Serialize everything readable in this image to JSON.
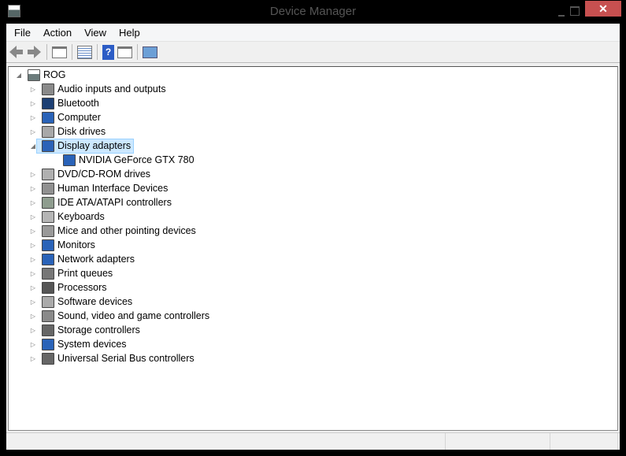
{
  "window": {
    "title": "Device Manager",
    "close": "✕"
  },
  "menu": [
    "File",
    "Action",
    "View",
    "Help"
  ],
  "toolbar": [
    "back-icon",
    "forward-icon",
    "show-hide-console-tree-icon",
    "properties-icon",
    "help-icon",
    "show-action-pane-icon",
    "scan-hardware-icon"
  ],
  "tree": {
    "root": "ROG",
    "categories": [
      {
        "label": "Audio inputs and outputs",
        "icon": "speaker-icon",
        "color": "#8a8a8a"
      },
      {
        "label": "Bluetooth",
        "icon": "bluetooth-icon",
        "color": "#1c3f73"
      },
      {
        "label": "Computer",
        "icon": "computer-icon",
        "color": "#2a63b8"
      },
      {
        "label": "Disk drives",
        "icon": "disk-drive-icon",
        "color": "#a8a8a8"
      },
      {
        "label": "Display adapters",
        "icon": "display-adapter-icon",
        "color": "#2a63b8",
        "expanded": true,
        "selected": true,
        "children": [
          "NVIDIA GeForce GTX 780"
        ]
      },
      {
        "label": "DVD/CD-ROM drives",
        "icon": "dvd-drive-icon",
        "color": "#b0b0b0"
      },
      {
        "label": "Human Interface Devices",
        "icon": "hid-icon",
        "color": "#909090"
      },
      {
        "label": "IDE ATA/ATAPI controllers",
        "icon": "ide-controller-icon",
        "color": "#8f9d8f"
      },
      {
        "label": "Keyboards",
        "icon": "keyboard-icon",
        "color": "#b5b5b5"
      },
      {
        "label": "Mice and other pointing devices",
        "icon": "mouse-icon",
        "color": "#999"
      },
      {
        "label": "Monitors",
        "icon": "monitor-icon",
        "color": "#2a63b8"
      },
      {
        "label": "Network adapters",
        "icon": "network-adapter-icon",
        "color": "#2a63b8"
      },
      {
        "label": "Print queues",
        "icon": "printer-icon",
        "color": "#777"
      },
      {
        "label": "Processors",
        "icon": "processor-icon",
        "color": "#555"
      },
      {
        "label": "Software devices",
        "icon": "software-device-icon",
        "color": "#aaa"
      },
      {
        "label": "Sound, video and game controllers",
        "icon": "sound-icon",
        "color": "#8a8a8a"
      },
      {
        "label": "Storage controllers",
        "icon": "storage-controller-icon",
        "color": "#666"
      },
      {
        "label": "System devices",
        "icon": "system-devices-icon",
        "color": "#2a63b8"
      },
      {
        "label": "Universal Serial Bus controllers",
        "icon": "usb-icon",
        "color": "#666"
      }
    ]
  }
}
